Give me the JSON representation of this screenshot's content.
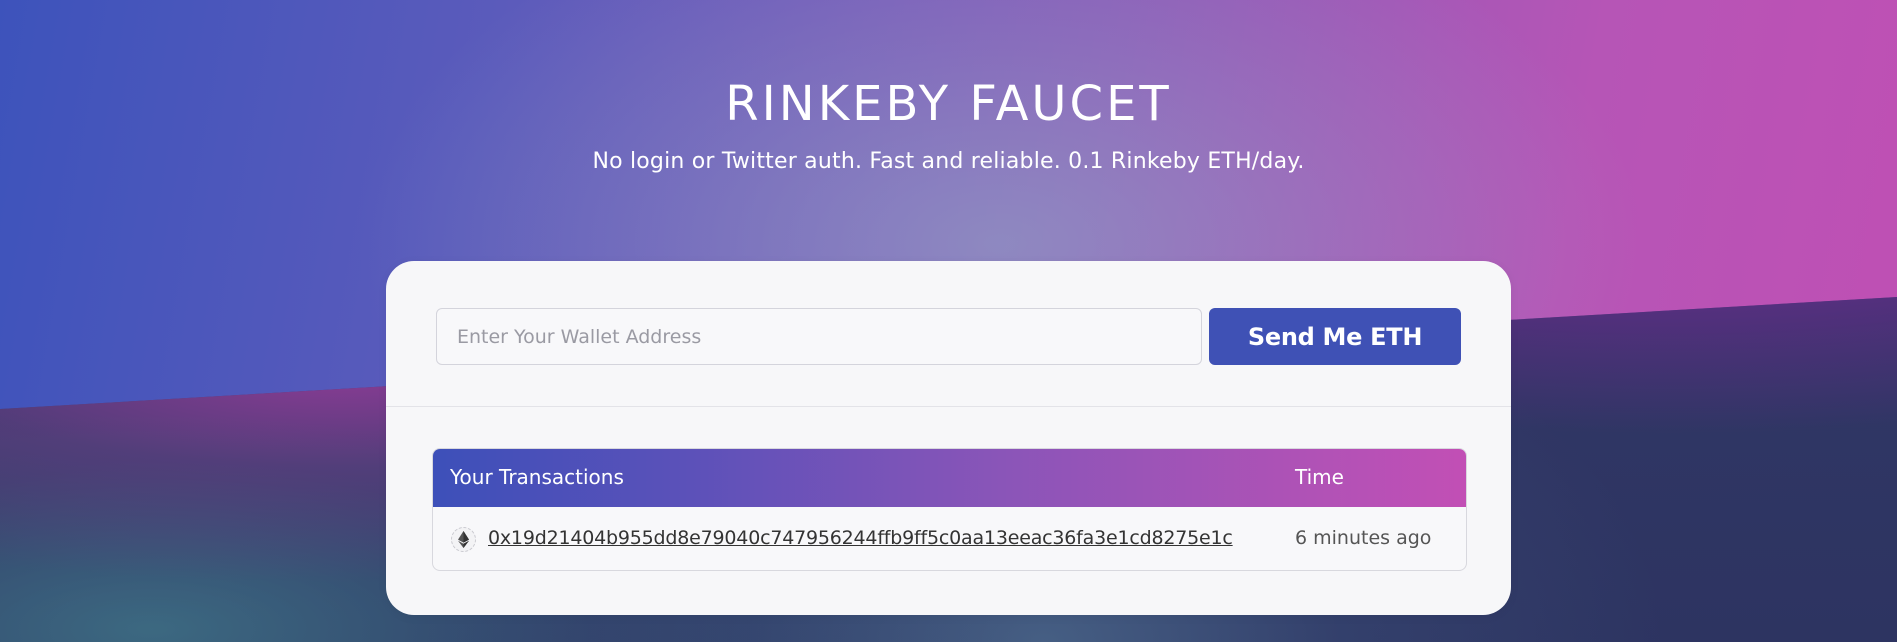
{
  "header": {
    "title": "RINKEBY FAUCET",
    "subtitle": "No login or Twitter auth. Fast and reliable. 0.1 Rinkeby ETH/day."
  },
  "form": {
    "wallet_placeholder": "Enter Your Wallet Address",
    "wallet_value": "",
    "send_label": "Send Me ETH"
  },
  "transactions": {
    "headers": {
      "transaction": "Your Transactions",
      "time": "Time"
    },
    "rows": [
      {
        "icon": "ethereum-icon",
        "hash": "0x19d21404b955dd8e79040c747956244ffb9ff5c0aa13eeac36fa3e1cd8275e1c",
        "time": "6 minutes ago"
      }
    ]
  },
  "colors": {
    "accent": "#3f51b5",
    "gradient_start": "#3d53bb",
    "gradient_end": "#c04fb4",
    "card_background": "#f7f7f9"
  }
}
